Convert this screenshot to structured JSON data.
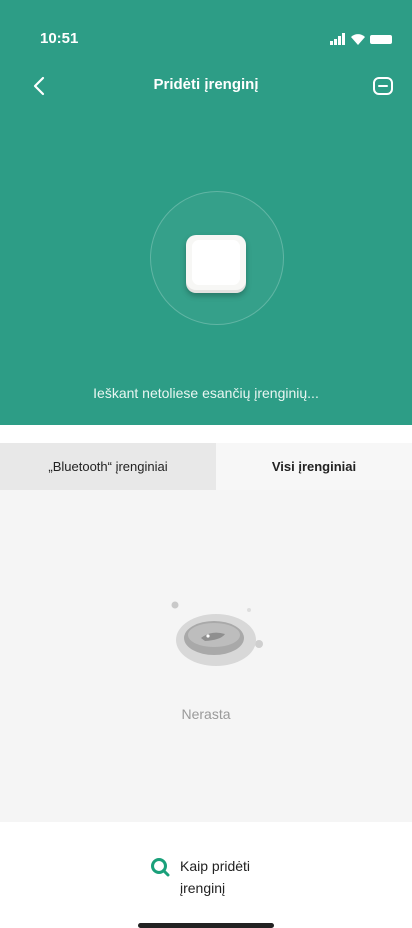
{
  "status": {
    "time": "10:51"
  },
  "header": {
    "title": "Pridėti įrenginį"
  },
  "search": {
    "status_text": "Ieškant netoliese esančių įrenginių..."
  },
  "tabs": [
    {
      "label": "„Bluetooth“ įrenginiai",
      "selected": false
    },
    {
      "label": "Visi įrenginiai",
      "selected": true
    }
  ],
  "empty_state": {
    "text": "Nerasta"
  },
  "help": {
    "label": "Kaip pridėti įrenginį",
    "icon": "search-help-icon"
  },
  "colors": {
    "accent": "#2d9d86",
    "help_icon": "#1aa07a",
    "background": "#f5f5f5"
  }
}
